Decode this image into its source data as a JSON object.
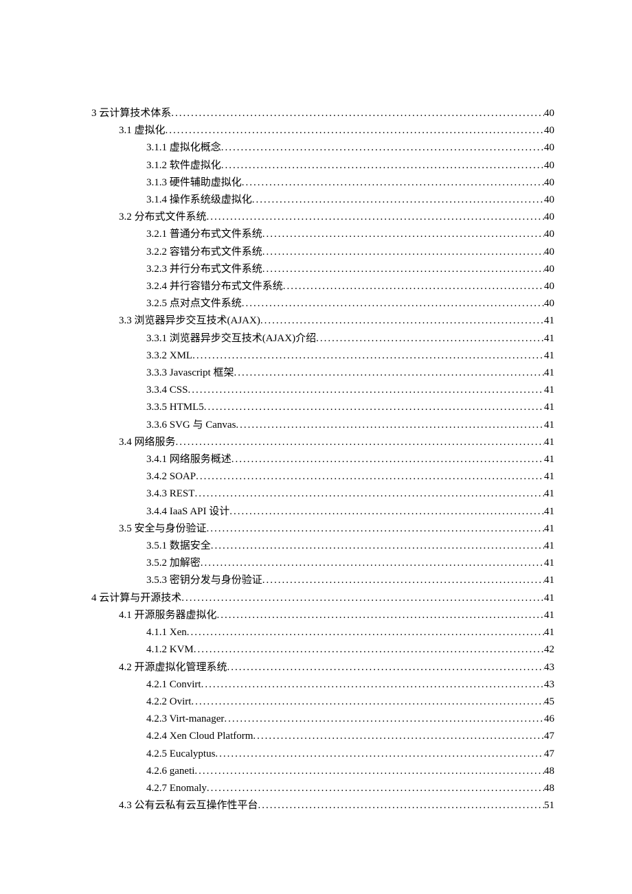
{
  "toc": [
    {
      "level": 0,
      "title": "3 云计算技术体系",
      "page": "40"
    },
    {
      "level": 1,
      "title": "3.1 虚拟化",
      "page": "40"
    },
    {
      "level": 2,
      "title": "3.1.1 虚拟化概念",
      "page": "40"
    },
    {
      "level": 2,
      "title": "3.1.2 软件虚拟化",
      "page": "40"
    },
    {
      "level": 2,
      "title": "3.1.3 硬件辅助虚拟化",
      "page": "40"
    },
    {
      "level": 2,
      "title": "3.1.4 操作系统级虚拟化",
      "page": "40"
    },
    {
      "level": 1,
      "title": "3.2 分布式文件系统",
      "page": "40"
    },
    {
      "level": 2,
      "title": "3.2.1 普通分布式文件系统",
      "page": "40"
    },
    {
      "level": 2,
      "title": "3.2.2 容错分布式文件系统",
      "page": "40"
    },
    {
      "level": 2,
      "title": "3.2.3 并行分布式文件系统",
      "page": "40"
    },
    {
      "level": 2,
      "title": "3.2.4 并行容错分布式文件系统",
      "page": "40"
    },
    {
      "level": 2,
      "title": "3.2.5 点对点文件系统",
      "page": "40"
    },
    {
      "level": 1,
      "title": "3.3 浏览器异步交互技术(AJAX)",
      "page": "41"
    },
    {
      "level": 2,
      "title": "3.3.1 浏览器异步交互技术(AJAX)介绍",
      "page": "41"
    },
    {
      "level": 2,
      "title": "3.3.2 XML",
      "page": "41"
    },
    {
      "level": 2,
      "title": "3.3.3 Javascript 框架",
      "page": "41"
    },
    {
      "level": 2,
      "title": "3.3.4 CSS",
      "page": "41"
    },
    {
      "level": 2,
      "title": "3.3.5 HTML5",
      "page": "41"
    },
    {
      "level": 2,
      "title": "3.3.6 SVG 与 Canvas",
      "page": "41"
    },
    {
      "level": 1,
      "title": "3.4 网络服务",
      "page": "41"
    },
    {
      "level": 2,
      "title": "3.4.1 网络服务概述",
      "page": "41"
    },
    {
      "level": 2,
      "title": "3.4.2 SOAP",
      "page": "41"
    },
    {
      "level": 2,
      "title": "3.4.3 REST",
      "page": "41"
    },
    {
      "level": 2,
      "title": "3.4.4 IaaS API 设计",
      "page": "41"
    },
    {
      "level": 1,
      "title": "3.5 安全与身份验证",
      "page": "41"
    },
    {
      "level": 2,
      "title": "3.5.1 数据安全",
      "page": "41"
    },
    {
      "level": 2,
      "title": "3.5.2 加解密",
      "page": "41"
    },
    {
      "level": 2,
      "title": "3.5.3 密钥分发与身份验证",
      "page": "41"
    },
    {
      "level": 0,
      "title": "4 云计算与开源技术",
      "page": "41"
    },
    {
      "level": 1,
      "title": "4.1 开源服务器虚拟化",
      "page": "41"
    },
    {
      "level": 2,
      "title": "4.1.1 Xen",
      "page": "41"
    },
    {
      "level": 2,
      "title": "4.1.2 KVM",
      "page": "42"
    },
    {
      "level": 1,
      "title": "4.2 开源虚拟化管理系统",
      "page": "43"
    },
    {
      "level": 2,
      "title": "4.2.1 Convirt",
      "page": "43"
    },
    {
      "level": 2,
      "title": "4.2.2 Ovirt",
      "page": "45"
    },
    {
      "level": 2,
      "title": "4.2.3 Virt-manager",
      "page": "46"
    },
    {
      "level": 2,
      "title": "4.2.4 Xen Cloud Platform ",
      "page": "47"
    },
    {
      "level": 2,
      "title": "4.2.5 Eucalyptus",
      "page": "47"
    },
    {
      "level": 2,
      "title": "4.2.6 ganeti",
      "page": "48"
    },
    {
      "level": 2,
      "title": "4.2.7 Enomaly",
      "page": "48"
    },
    {
      "level": 1,
      "title": "4.3 公有云私有云互操作性平台",
      "page": "51"
    }
  ]
}
